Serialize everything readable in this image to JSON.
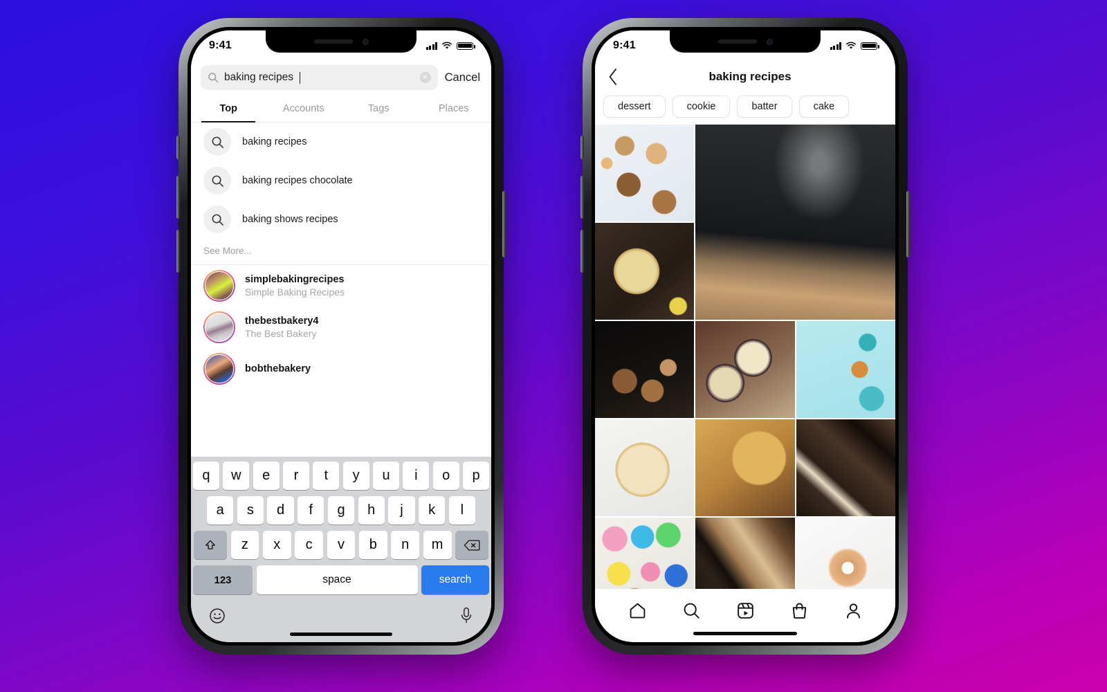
{
  "background": {
    "from": "#2c0fe0",
    "to": "#cc00ad"
  },
  "accent": {
    "ios_blue": "#2a7bf0",
    "key_gray": "#adb1b9",
    "keyboard_bg": "#d2d4d8"
  },
  "left_phone": {
    "status": {
      "time": "9:41",
      "signal_icon": "cellular-signal-icon",
      "wifi_icon": "wifi-icon",
      "battery_icon": "battery-icon"
    },
    "search": {
      "search_icon": "search-icon",
      "value": "baking recipes",
      "placeholder": "Search",
      "clear_icon": "clear-circle-icon",
      "cancel_label": "Cancel"
    },
    "tabs": [
      {
        "label": "Top",
        "active": true
      },
      {
        "label": "Accounts",
        "active": false
      },
      {
        "label": "Tags",
        "active": false
      },
      {
        "label": "Places",
        "active": false
      }
    ],
    "suggestions": [
      {
        "icon": "search-icon",
        "label": "baking recipes"
      },
      {
        "icon": "search-icon",
        "label": "baking recipes chocolate"
      },
      {
        "icon": "search-icon",
        "label": "baking shows recipes"
      }
    ],
    "see_more_label": "See More...",
    "accounts": [
      {
        "username": "simplebakingrecipes",
        "fullname": "Simple Baking Recipes",
        "avatar": "avatar-simplebakingrecipes"
      },
      {
        "username": "thebestbakery4",
        "fullname": "The Best Bakery",
        "avatar": "avatar-thebestbakery4"
      },
      {
        "username": "bobthebakery",
        "fullname": "",
        "avatar": "avatar-bobthebakery"
      }
    ],
    "keyboard": {
      "row1": [
        "q",
        "w",
        "e",
        "r",
        "t",
        "y",
        "u",
        "i",
        "o",
        "p"
      ],
      "row2": [
        "a",
        "s",
        "d",
        "f",
        "g",
        "h",
        "j",
        "k",
        "l"
      ],
      "row3": [
        "z",
        "x",
        "c",
        "v",
        "b",
        "n",
        "m"
      ],
      "shift_icon": "shift-arrow-icon",
      "backspace_icon": "backspace-icon",
      "numbers_label": "123",
      "space_label": "space",
      "return_label": "search",
      "emoji_icon": "emoji-smiley-icon",
      "mic_icon": "microphone-icon"
    }
  },
  "right_phone": {
    "status": {
      "time": "9:41",
      "signal_icon": "cellular-signal-icon",
      "wifi_icon": "wifi-icon",
      "battery_icon": "battery-icon"
    },
    "header": {
      "back_icon": "chevron-left-icon",
      "title": "baking recipes"
    },
    "chips": [
      {
        "label": "dessert"
      },
      {
        "label": "cookie"
      },
      {
        "label": "batter"
      },
      {
        "label": "cake"
      }
    ],
    "grid": [
      {
        "name": "assorted-pies-marble",
        "style": "p-pies",
        "span": ""
      },
      {
        "name": "sifting-sugar-pastry",
        "style": "p-dust",
        "span": "tall2 wide2"
      },
      {
        "name": "lattice-pie-dark",
        "style": "p-lattice",
        "span": ""
      },
      {
        "name": "muffins-dark",
        "style": "p-muffin",
        "span": ""
      },
      {
        "name": "berry-lattice-pies",
        "style": "p-berry",
        "span": ""
      },
      {
        "name": "macarons-mint",
        "style": "p-mint",
        "span": ""
      },
      {
        "name": "golden-tart",
        "style": "p-tart",
        "span": ""
      },
      {
        "name": "crumble-pie",
        "style": "p-crumble",
        "span": ""
      },
      {
        "name": "chocolate-chunks",
        "style": "p-choc",
        "span": ""
      },
      {
        "name": "colorful-donuts",
        "style": "p-donuts",
        "span": ""
      },
      {
        "name": "spatula-pie",
        "style": "p-spatula",
        "span": ""
      },
      {
        "name": "glazed-donut-bite",
        "style": "p-ring",
        "span": ""
      }
    ],
    "navbar": [
      {
        "icon": "home-icon",
        "name": "nav-home"
      },
      {
        "icon": "search-icon",
        "name": "nav-search"
      },
      {
        "icon": "reels-icon",
        "name": "nav-reels"
      },
      {
        "icon": "shop-icon",
        "name": "nav-shop"
      },
      {
        "icon": "profile-icon",
        "name": "nav-profile"
      }
    ]
  }
}
